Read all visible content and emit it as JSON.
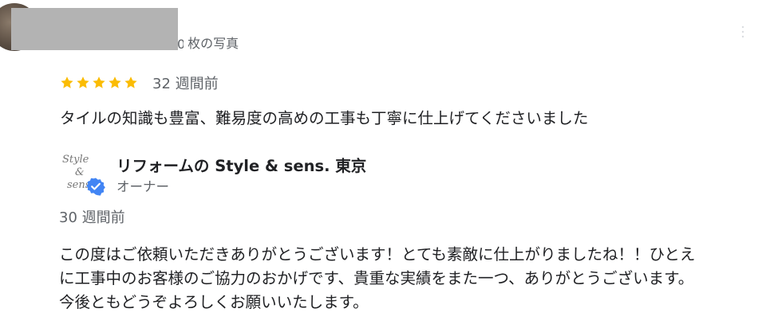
{
  "reviewer": {
    "photo_count_suffix": "枚の写真",
    "photo_count_visible_digit": "0"
  },
  "review": {
    "rating": 5,
    "rating_max": 5,
    "time": "32 週間前",
    "text": "タイルの知識も豊富、難易度の高めの工事も丁寧に仕上げてくださいました"
  },
  "owner_response": {
    "logo": {
      "word1": "Style",
      "word2": "&",
      "word3": "sens"
    },
    "name": "リフォームの Style & sens. 東京",
    "role": "オーナー",
    "time": "30 週間前",
    "text_lines": [
      "この度はご依頼いただきありがとうございます！とても素敵に仕上がりましたね！！ひとえ",
      "に工事中のお客様のご協力のおかげです、貴重な実績をまた一つ、ありがとうございます。",
      "今後ともどうぞよろしくお願いいたします。"
    ]
  },
  "colors": {
    "star": "#fbbc04",
    "text_primary": "#202124",
    "text_secondary": "#5f6368",
    "verified_badge": "#4285f4",
    "redaction": "#b3b3b3"
  },
  "icons": {
    "star": "star-icon",
    "verified": "verified-check-icon",
    "more": "more-vert-icon"
  }
}
